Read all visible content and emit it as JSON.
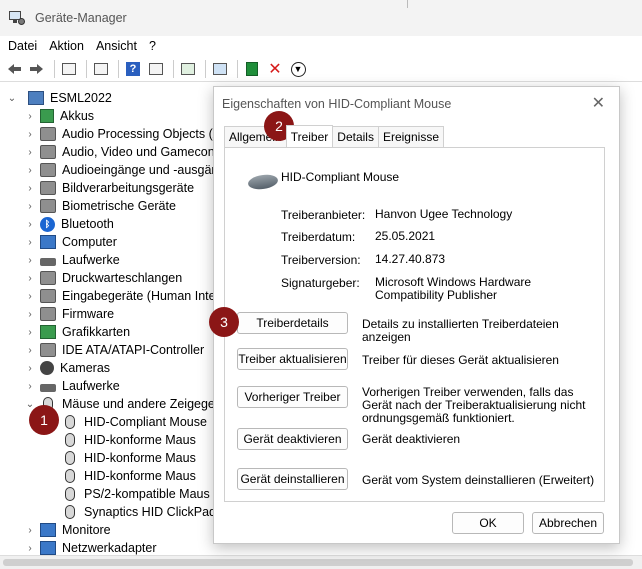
{
  "window": {
    "title": "Geräte-Manager"
  },
  "menu": [
    "Datei",
    "Aktion",
    "Ansicht",
    "?"
  ],
  "tree": {
    "root": "ESML2022",
    "categories": [
      {
        "label": "Akkus",
        "icon": "battery-icon"
      },
      {
        "label": "Audio Processing Objects (AI",
        "icon": "speaker-icon"
      },
      {
        "label": "Audio, Video und Gamecontr",
        "icon": "speaker-icon"
      },
      {
        "label": "Audioeingänge und -ausgän",
        "icon": "speaker-icon"
      },
      {
        "label": "Bildverarbeitungsgeräte",
        "icon": "camera-icon"
      },
      {
        "label": "Biometrische Geräte",
        "icon": "biometric-icon"
      },
      {
        "label": "Bluetooth",
        "icon": "bluetooth-icon"
      },
      {
        "label": "Computer",
        "icon": "computer-icon"
      },
      {
        "label": "Laufwerke",
        "icon": "drive-icon"
      },
      {
        "label": "Druckwarteschlangen",
        "icon": "printer-icon"
      },
      {
        "label": "Eingabegeräte (Human Interf",
        "icon": "keyboard-icon"
      },
      {
        "label": "Firmware",
        "icon": "firmware-icon"
      },
      {
        "label": "Grafikkarten",
        "icon": "display-adapter-icon"
      },
      {
        "label": "IDE ATA/ATAPI-Controller",
        "icon": "controller-icon"
      },
      {
        "label": "Kameras",
        "icon": "camera-icon"
      },
      {
        "label": "Laufwerke",
        "icon": "drive-icon"
      },
      {
        "label": "Mäuse und andere Zeigegerä",
        "icon": "mouse-icon"
      }
    ],
    "mice": [
      "HID-Compliant Mouse",
      "HID-konforme Maus",
      "HID-konforme Maus",
      "HID-konforme Maus",
      "PS/2-kompatible Maus",
      "Synaptics HID ClickPad"
    ],
    "after": [
      "Monitore",
      "Netzwerkadapter"
    ]
  },
  "dialog": {
    "title": "Eigenschaften von HID-Compliant Mouse",
    "tabs": [
      "Allgemein",
      "Treiber",
      "Details",
      "Ereignisse"
    ],
    "device_name": "HID-Compliant Mouse",
    "props": [
      {
        "label": "Treiberanbieter:",
        "value": "Hanvon Ugee Technology"
      },
      {
        "label": "Treiberdatum:",
        "value": "25.05.2021"
      },
      {
        "label": "Treiberversion:",
        "value": "14.27.40.873"
      },
      {
        "label": "Signaturgeber:",
        "value": "Microsoft Windows Hardware Compatibility Publisher"
      }
    ],
    "buttons": [
      {
        "label": "Treiberdetails",
        "desc": "Details zu installierten Treiberdateien anzeigen"
      },
      {
        "label": "Treiber aktualisieren",
        "desc": "Treiber für dieses Gerät aktualisieren"
      },
      {
        "label": "Vorheriger Treiber",
        "desc": "Vorherigen Treiber verwenden, falls das Gerät nach der Treiberaktualisierung nicht ordnungsgemäß funktioniert."
      },
      {
        "label": "Gerät deaktivieren",
        "desc": "Gerät deaktivieren"
      },
      {
        "label": "Gerät deinstallieren",
        "desc": "Gerät vom System deinstallieren (Erweitert)"
      }
    ],
    "ok": "OK",
    "cancel": "Abbrechen"
  },
  "badges": [
    "1",
    "2",
    "3"
  ],
  "colors": {
    "badge": "#8b1616"
  }
}
